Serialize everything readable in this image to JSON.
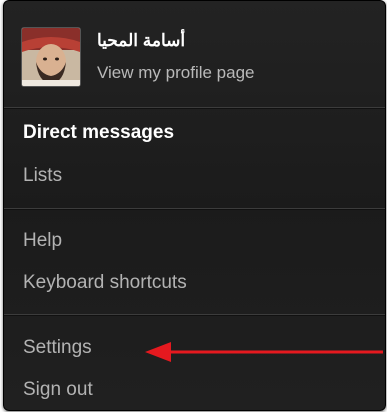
{
  "profile": {
    "name": "أسامة المحيا",
    "link_label": "View my profile page"
  },
  "menu": {
    "group1": [
      "Direct messages",
      "Lists"
    ],
    "group2": [
      "Help",
      "Keyboard shortcuts"
    ],
    "group3": [
      "Settings",
      "Sign out"
    ]
  },
  "colors": {
    "annotation_arrow": "#e5191f",
    "menu_background": "#1f1f1f"
  }
}
